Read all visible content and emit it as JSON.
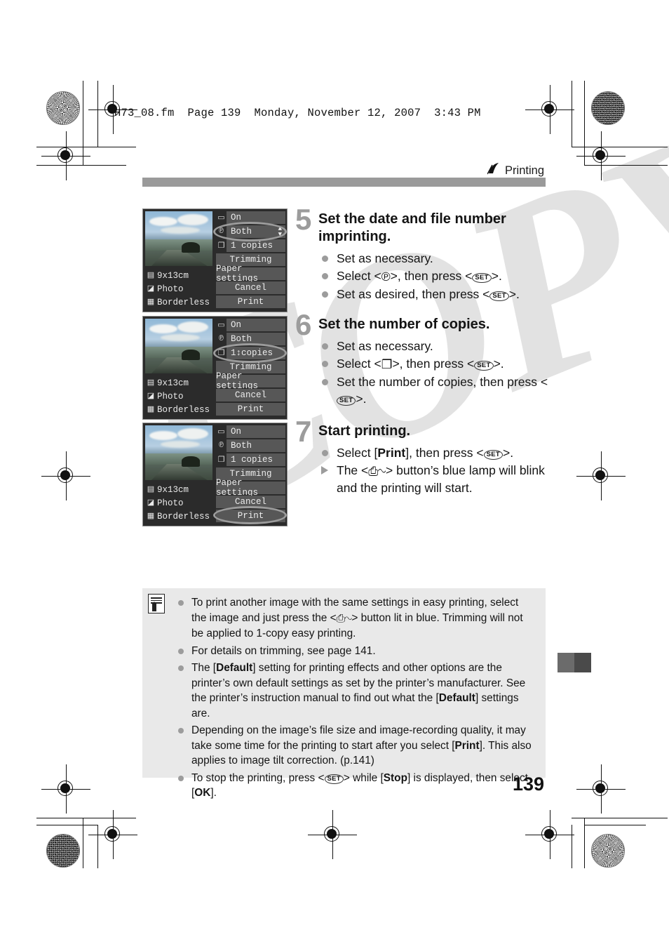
{
  "document": {
    "fm_header": "H73_08.fm  Page 139  Monday, November 12, 2007  3:43 PM",
    "chapter": "Printing",
    "chapter_icon": "printer-swoosh-icon",
    "page_number": "139",
    "watermark": "COPY"
  },
  "lcd_screens": [
    {
      "id": "screen-step5",
      "left_labels": [
        {
          "icon": "paper-size-icon",
          "text": "9x13cm"
        },
        {
          "icon": "paper-type-icon",
          "text": "Photo"
        },
        {
          "icon": "page-layout-icon",
          "text": "Borderless"
        }
      ],
      "menu_items": [
        {
          "icon": "printing-effect-icon",
          "label": "On",
          "type": "value"
        },
        {
          "icon": "date-imprint-icon",
          "label": "Both",
          "type": "value",
          "arrows": true
        },
        {
          "icon": "copies-icon",
          "label": "1  copies",
          "type": "value"
        },
        {
          "icon": "",
          "label": "Trimming",
          "type": "button"
        },
        {
          "icon": "",
          "label": "Paper settings",
          "type": "button"
        },
        {
          "icon": "",
          "label": "Cancel",
          "type": "button"
        },
        {
          "icon": "",
          "label": "Print",
          "type": "button"
        }
      ],
      "highlight_index": 1
    },
    {
      "id": "screen-step6",
      "left_labels": [
        {
          "icon": "paper-size-icon",
          "text": "9x13cm"
        },
        {
          "icon": "paper-type-icon",
          "text": "Photo"
        },
        {
          "icon": "page-layout-icon",
          "text": "Borderless"
        }
      ],
      "menu_items": [
        {
          "icon": "printing-effect-icon",
          "label": "On",
          "type": "value"
        },
        {
          "icon": "date-imprint-icon",
          "label": "Both",
          "type": "value"
        },
        {
          "icon": "copies-icon",
          "label": "1↕copies",
          "type": "value"
        },
        {
          "icon": "",
          "label": "Trimming",
          "type": "button"
        },
        {
          "icon": "",
          "label": "Paper settings",
          "type": "button"
        },
        {
          "icon": "",
          "label": "Cancel",
          "type": "button"
        },
        {
          "icon": "",
          "label": "Print",
          "type": "button"
        }
      ],
      "highlight_index": 2
    },
    {
      "id": "screen-step7",
      "left_labels": [
        {
          "icon": "paper-size-icon",
          "text": "9x13cm"
        },
        {
          "icon": "paper-type-icon",
          "text": "Photo"
        },
        {
          "icon": "page-layout-icon",
          "text": "Borderless"
        }
      ],
      "menu_items": [
        {
          "icon": "printing-effect-icon",
          "label": "On",
          "type": "value"
        },
        {
          "icon": "date-imprint-icon",
          "label": "Both",
          "type": "value"
        },
        {
          "icon": "copies-icon",
          "label": "1  copies",
          "type": "value"
        },
        {
          "icon": "",
          "label": "Trimming",
          "type": "button"
        },
        {
          "icon": "",
          "label": "Paper settings",
          "type": "button"
        },
        {
          "icon": "",
          "label": "Cancel",
          "type": "button"
        },
        {
          "icon": "",
          "label": "Print",
          "type": "button"
        }
      ],
      "highlight_index": 6
    }
  ],
  "steps": [
    {
      "number": "5",
      "title": "Set the date and file number imprinting.",
      "bullets": [
        {
          "kind": "dot",
          "html": "Set as necessary."
        },
        {
          "kind": "dot",
          "html": "Select &lt;<span class=\"glyph\" data-name=\"date-imprint-icon\">℗</span>&gt;, then press &lt;<span class=\"kc\" data-name=\"set-button-icon\">SET</span>&gt;."
        },
        {
          "kind": "dot",
          "html": "Set as desired, then press &lt;<span class=\"kc\" data-name=\"set-button-icon\">SET</span>&gt;."
        }
      ]
    },
    {
      "number": "6",
      "title": "Set the number of copies.",
      "bullets": [
        {
          "kind": "dot",
          "html": "Set as necessary."
        },
        {
          "kind": "dot",
          "html": "Select &lt;<span class=\"glyph\" data-name=\"copies-icon\">❐</span>&gt;, then press &lt;<span class=\"kc\" data-name=\"set-button-icon\">SET</span>&gt;."
        },
        {
          "kind": "dot",
          "html": "Set the number of copies, then press &lt;<span class=\"kc\" data-name=\"set-button-icon\">SET</span>&gt;."
        }
      ]
    },
    {
      "number": "7",
      "title": "Start printing.",
      "bullets": [
        {
          "kind": "dot",
          "html": "Select [<b>Print</b>], then press &lt;<span class=\"kc\" data-name=\"set-button-icon\">SET</span>&gt;."
        },
        {
          "kind": "tri",
          "html": "The &lt;<span class=\"glyph\" data-name=\"direct-print-button-icon\">⎙∿</span>&gt; button’s blue lamp will blink and the printing will start."
        }
      ]
    }
  ],
  "note_box": {
    "icon": "note-document-icon",
    "items": [
      {
        "html": "To print another image with the same settings in easy printing, select the image and just press the &lt;<span class=\"glyph\" data-name=\"direct-print-button-icon\">⎙∿</span>&gt; button lit in blue. Trimming will not be applied to 1-copy easy printing."
      },
      {
        "html": "For details on trimming, see page 141."
      },
      {
        "html": "The [<b>Default</b>] setting for printing effects and other options are the printer’s own default settings as set by the printer’s manufacturer. See the printer’s instruction manual to find out what the [<b>Default</b>] settings are."
      },
      {
        "html": "Depending on the image’s file size and image-recording quality, it may take some time for the printing to start after you select [<b>Print</b>]. This also applies to image tilt correction. (p.141)"
      },
      {
        "html": "To stop the printing, press &lt;<span class=\"kc\" data-name=\"set-button-icon\">SET</span>&gt; while [<b>Stop</b>] is displayed, then select [<b>OK</b>]."
      }
    ]
  },
  "colors": {
    "rule_bar": "#9a9a9a",
    "note_bg": "#e9e9e9",
    "lcd_bg": "#2b2b2b",
    "lcd_item": "#575757",
    "step_num": "#9c9c9c",
    "watermark": "#e2e2e2"
  }
}
